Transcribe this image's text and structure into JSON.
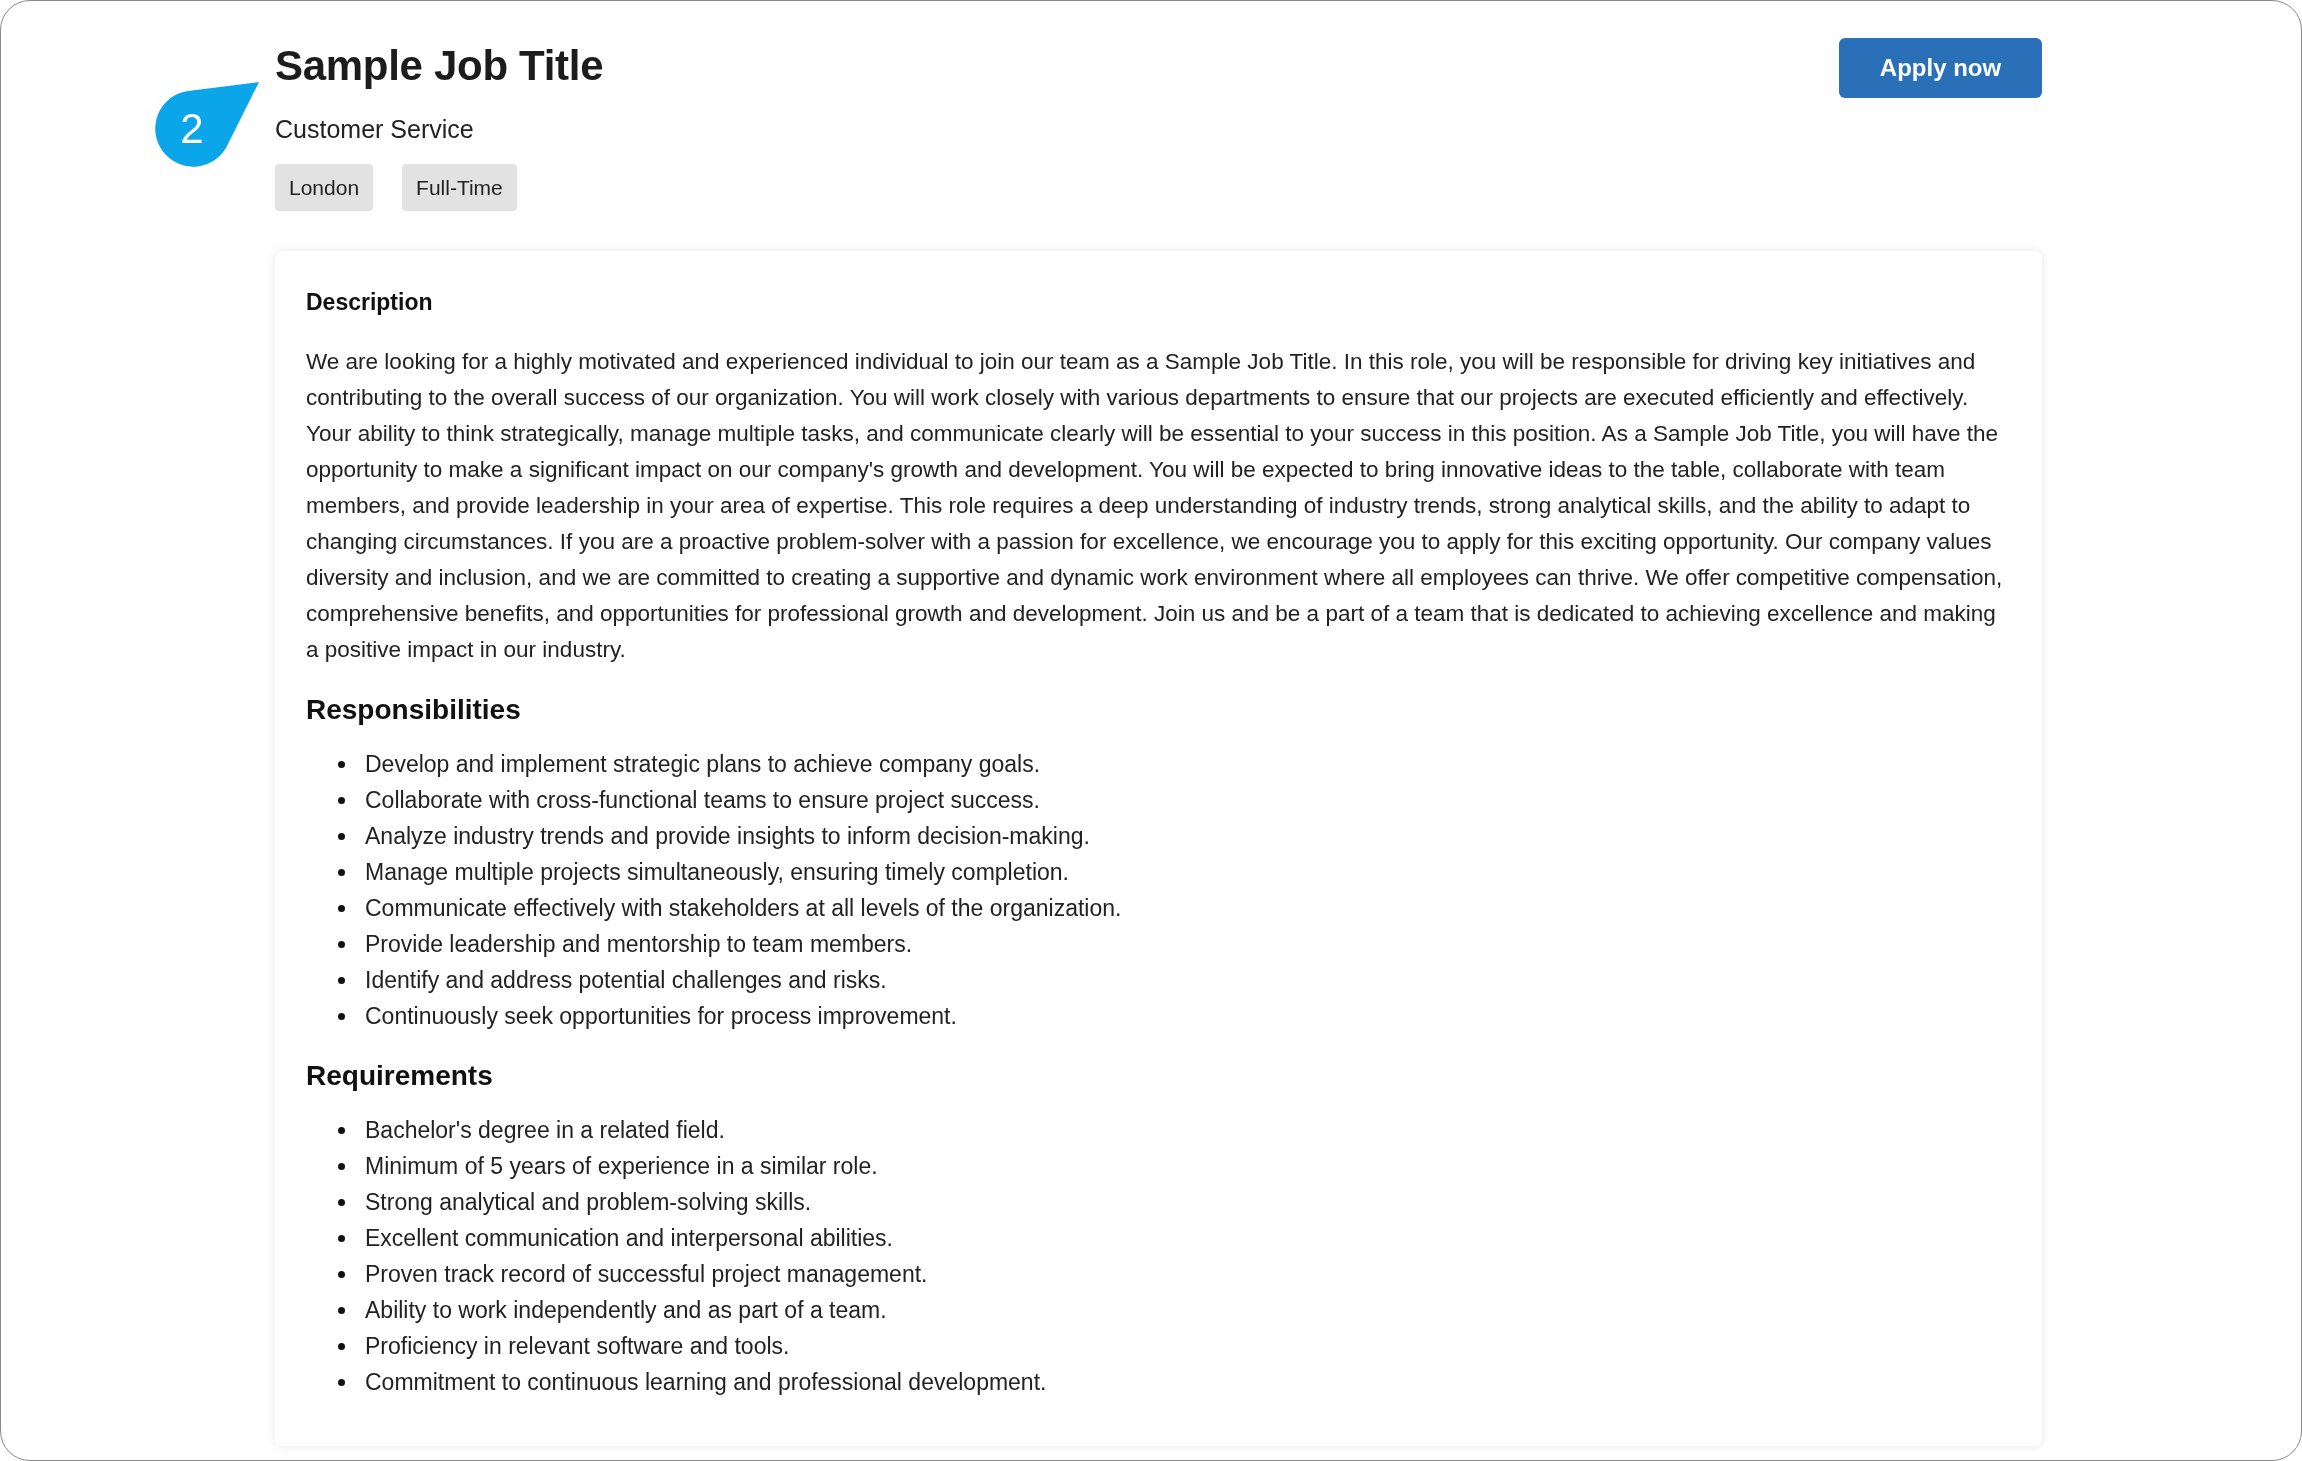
{
  "annotation": {
    "label": "2"
  },
  "header": {
    "title": "Sample Job Title",
    "department": "Customer Service",
    "tags": [
      "London",
      "Full-Time"
    ],
    "apply_button": "Apply now"
  },
  "card": {
    "description": {
      "heading": "Description",
      "text": "We are looking for a highly motivated and experienced individual to join our team as a Sample Job Title. In this role, you will be responsible for driving key initiatives and contributing to the overall success of our organization. You will work closely with various departments to ensure that our projects are executed efficiently and effectively. Your ability to think strategically, manage multiple tasks, and communicate clearly will be essential to your success in this position. As a Sample Job Title, you will have the opportunity to make a significant impact on our company's growth and development. You will be expected to bring innovative ideas to the table, collaborate with team members, and provide leadership in your area of expertise. This role requires a deep understanding of industry trends, strong analytical skills, and the ability to adapt to changing circumstances. If you are a proactive problem-solver with a passion for excellence, we encourage you to apply for this exciting opportunity. Our company values diversity and inclusion, and we are committed to creating a supportive and dynamic work environment where all employees can thrive. We offer competitive compensation, comprehensive benefits, and opportunities for professional growth and development. Join us and be a part of a team that is dedicated to achieving excellence and making a positive impact in our industry."
    },
    "sections": [
      {
        "heading": "Responsibilities",
        "items": [
          "Develop and implement strategic plans to achieve company goals.",
          "Collaborate with cross-functional teams to ensure project success.",
          "Analyze industry trends and provide insights to inform decision-making.",
          "Manage multiple projects simultaneously, ensuring timely completion.",
          "Communicate effectively with stakeholders at all levels of the organization.",
          "Provide leadership and mentorship to team members.",
          "Identify and address potential challenges and risks.",
          "Continuously seek opportunities for process improvement."
        ]
      },
      {
        "heading": "Requirements",
        "items": [
          "Bachelor's degree in a related field.",
          "Minimum of 5 years of experience in a similar role.",
          "Strong analytical and problem-solving skills.",
          "Excellent communication and interpersonal abilities.",
          "Proven track record of successful project management.",
          "Ability to work independently and as part of a team.",
          "Proficiency in relevant software and tools.",
          "Commitment to continuous learning and professional development."
        ]
      }
    ]
  }
}
